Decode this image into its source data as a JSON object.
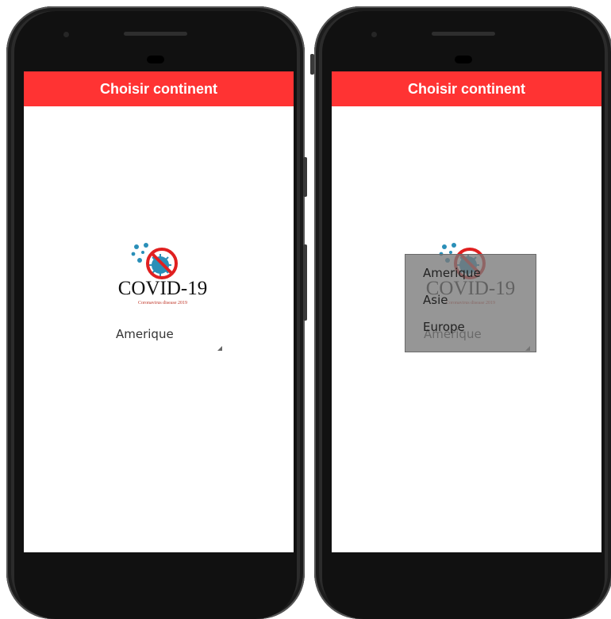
{
  "app": {
    "title": "Choisir continent"
  },
  "logo": {
    "text": "COVID-19",
    "subtitle": "Coronavirus disease 2019"
  },
  "spinner": {
    "selected": "Amerique"
  },
  "dropdown": {
    "options": [
      "Amerique",
      "Asie",
      "Europe"
    ]
  },
  "colors": {
    "appbar": "#ff3333",
    "virus": "#2a8fb8",
    "prohibition": "#e02020"
  }
}
